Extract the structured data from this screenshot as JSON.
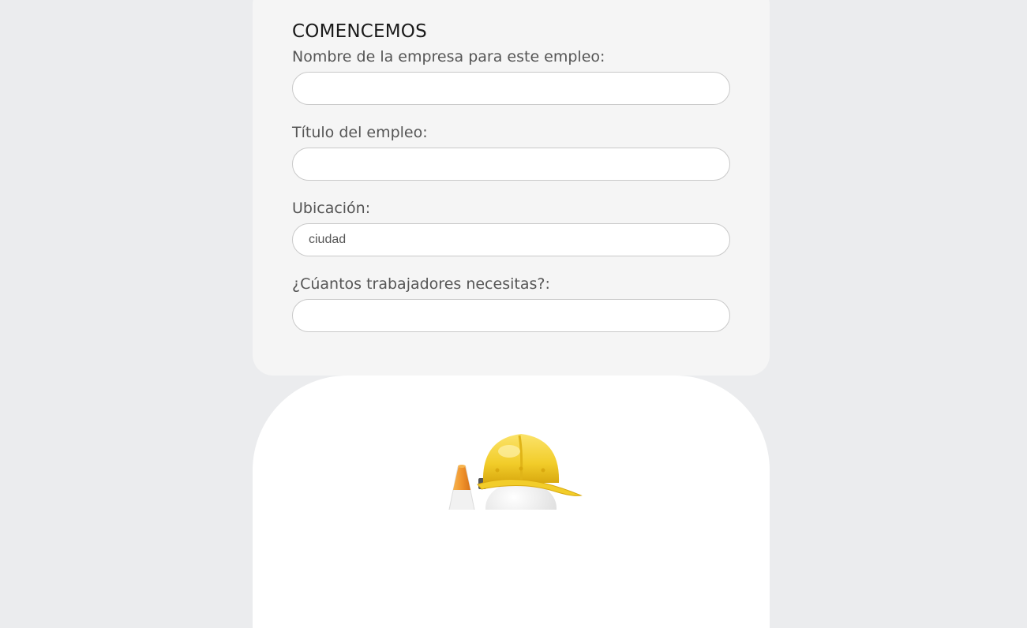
{
  "form": {
    "title": "COMENCEMOS",
    "fields": [
      {
        "label": "Nombre de la empresa para este empleo:",
        "value": "",
        "placeholder": ""
      },
      {
        "label": "Título del empleo:",
        "value": "",
        "placeholder": ""
      },
      {
        "label": "Ubicación:",
        "value": "",
        "placeholder": "ciudad"
      },
      {
        "label": "¿Cúantos trabajadores necesitas?:",
        "value": "",
        "placeholder": ""
      }
    ]
  },
  "hero": {
    "image_icon": "construction-worker-hardhat-icon",
    "colors": {
      "hardhat": "#f2cd2a",
      "cone": "#f0932b"
    }
  },
  "colors": {
    "page_background": "#ebecee",
    "card_background": "#f5f5f5",
    "input_border": "#c9c9c9",
    "label_text": "#555555",
    "title_text": "#1a1a1a"
  }
}
